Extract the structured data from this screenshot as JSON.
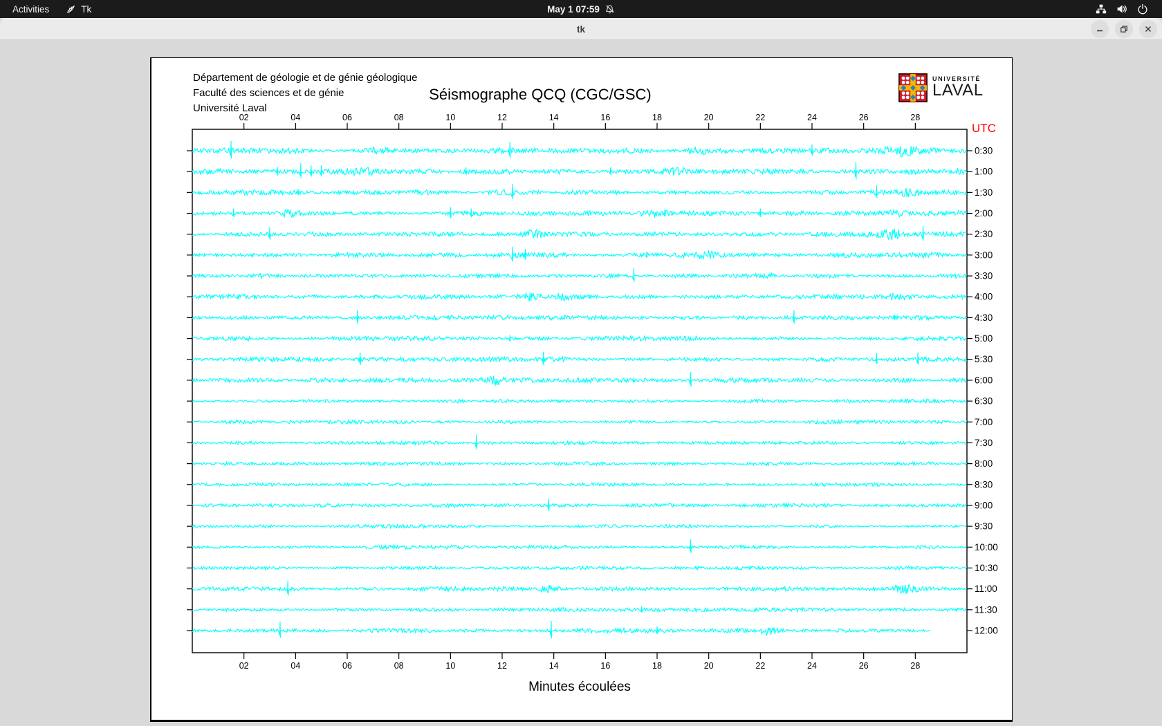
{
  "topbar": {
    "activities_label": "Activities",
    "app_menu_label": "Tk",
    "clock": "May 1 07:59"
  },
  "window": {
    "title": "tk"
  },
  "seismograph": {
    "institution_lines": [
      "Département de géologie et de génie géologique",
      "Faculté des sciences et de génie",
      "Université Laval"
    ],
    "title": "Séismographe QCQ (CGC/GSC)",
    "logo": {
      "top": "UNIVERSITÉ",
      "bottom": "LAVAL"
    },
    "utc_label": "UTC",
    "xlabel": "Minutes écoulées",
    "colors": {
      "trace": "#00ffff",
      "utc": "#ff0000",
      "axis": "#000000"
    }
  },
  "chart_data": {
    "type": "line",
    "subtype": "helicorder-seismograph",
    "title": "Séismographe QCQ (CGC/GSC)",
    "xlabel": "Minutes écoulées",
    "x_axis": {
      "min": 0,
      "max": 30,
      "tick_step": 2,
      "tick_labels": [
        "02",
        "04",
        "06",
        "08",
        "10",
        "12",
        "14",
        "16",
        "18",
        "20",
        "22",
        "24",
        "26",
        "28"
      ]
    },
    "y_axis_right_label": "UTC",
    "trace_color": "#00ffff",
    "rows": [
      {
        "label": "0:30",
        "amp": 2.8,
        "events": [
          {
            "m": 1.5,
            "t": "s",
            "a": 14
          },
          {
            "m": 7.3,
            "t": "b",
            "a": 3,
            "w": 0.6
          },
          {
            "m": 12.3,
            "t": "s",
            "a": 13
          },
          {
            "m": 19.6,
            "t": "b",
            "a": 4,
            "w": 0.6
          },
          {
            "m": 24.0,
            "t": "s",
            "a": 9
          },
          {
            "m": 27.5,
            "t": "b",
            "a": 5,
            "w": 0.9
          }
        ]
      },
      {
        "label": "1:00",
        "amp": 2.8,
        "events": [
          {
            "m": 3.3,
            "t": "s",
            "a": 7
          },
          {
            "m": 4.2,
            "t": "s",
            "a": 12
          },
          {
            "m": 4.6,
            "t": "s",
            "a": 9
          },
          {
            "m": 5.0,
            "t": "s",
            "a": 9
          },
          {
            "m": 6.6,
            "t": "b",
            "a": 4,
            "w": 0.5
          },
          {
            "m": 10.6,
            "t": "s",
            "a": 6
          },
          {
            "m": 16.2,
            "t": "s",
            "a": 6
          },
          {
            "m": 18.7,
            "t": "b",
            "a": 4,
            "w": 0.7
          },
          {
            "m": 25.7,
            "t": "s",
            "a": 14
          },
          {
            "m": 27.8,
            "t": "b",
            "a": 3,
            "w": 0.4
          }
        ]
      },
      {
        "label": "1:30",
        "amp": 2.6,
        "events": [
          {
            "m": 4.1,
            "t": "s",
            "a": 5
          },
          {
            "m": 12.4,
            "t": "s",
            "a": 12
          },
          {
            "m": 26.5,
            "t": "s",
            "a": 10
          },
          {
            "m": 27.7,
            "t": "b",
            "a": 5,
            "w": 0.7
          }
        ]
      },
      {
        "label": "2:00",
        "amp": 2.6,
        "events": [
          {
            "m": 1.6,
            "t": "s",
            "a": 7
          },
          {
            "m": 3.8,
            "t": "b",
            "a": 4,
            "w": 0.5
          },
          {
            "m": 10.0,
            "t": "s",
            "a": 9
          },
          {
            "m": 10.8,
            "t": "s",
            "a": 7
          },
          {
            "m": 17.9,
            "t": "b",
            "a": 4,
            "w": 0.8
          },
          {
            "m": 18.3,
            "t": "s",
            "a": 6
          },
          {
            "m": 22.0,
            "t": "s",
            "a": 7
          },
          {
            "m": 27.3,
            "t": "b",
            "a": 3,
            "w": 0.5
          }
        ]
      },
      {
        "label": "2:30",
        "amp": 2.6,
        "events": [
          {
            "m": 3.0,
            "t": "s",
            "a": 10
          },
          {
            "m": 13.2,
            "t": "b",
            "a": 5,
            "w": 0.6
          },
          {
            "m": 27.1,
            "t": "b",
            "a": 6,
            "w": 0.6
          },
          {
            "m": 28.3,
            "t": "s",
            "a": 12
          }
        ]
      },
      {
        "label": "3:00",
        "amp": 2.6,
        "events": [
          {
            "m": 12.4,
            "t": "s",
            "a": 12
          },
          {
            "m": 12.9,
            "t": "s",
            "a": 9
          },
          {
            "m": 17.6,
            "t": "s",
            "a": 5
          },
          {
            "m": 19.9,
            "t": "b",
            "a": 4,
            "w": 0.5
          }
        ]
      },
      {
        "label": "3:30",
        "amp": 2.4,
        "events": [
          {
            "m": 17.1,
            "t": "s",
            "a": 11
          }
        ]
      },
      {
        "label": "4:00",
        "amp": 2.4,
        "events": [
          {
            "m": 13.1,
            "t": "b",
            "a": 5,
            "w": 0.7
          },
          {
            "m": 14.3,
            "t": "b",
            "a": 4,
            "w": 0.5
          },
          {
            "m": 27.3,
            "t": "b",
            "a": 4,
            "w": 0.5
          }
        ]
      },
      {
        "label": "4:30",
        "amp": 2.4,
        "events": [
          {
            "m": 6.4,
            "t": "s",
            "a": 11
          },
          {
            "m": 23.3,
            "t": "s",
            "a": 11
          },
          {
            "m": 27.2,
            "t": "s",
            "a": 4
          }
        ]
      },
      {
        "label": "5:00",
        "amp": 2.2,
        "events": [
          {
            "m": 12.3,
            "t": "s",
            "a": 5
          }
        ]
      },
      {
        "label": "5:30",
        "amp": 2.4,
        "events": [
          {
            "m": 6.5,
            "t": "s",
            "a": 10
          },
          {
            "m": 13.6,
            "t": "s",
            "a": 11
          },
          {
            "m": 26.5,
            "t": "s",
            "a": 9
          },
          {
            "m": 28.1,
            "t": "s",
            "a": 10
          }
        ]
      },
      {
        "label": "6:00",
        "amp": 2.4,
        "events": [
          {
            "m": 11.8,
            "t": "b",
            "a": 5,
            "w": 0.5
          },
          {
            "m": 17.1,
            "t": "s",
            "a": 4
          },
          {
            "m": 19.3,
            "t": "s",
            "a": 12
          }
        ]
      },
      {
        "label": "6:30",
        "amp": 1.8,
        "events": []
      },
      {
        "label": "7:00",
        "amp": 1.9,
        "events": []
      },
      {
        "label": "7:30",
        "amp": 1.8,
        "events": [
          {
            "m": 11.0,
            "t": "s",
            "a": 12
          }
        ]
      },
      {
        "label": "8:00",
        "amp": 1.8,
        "events": []
      },
      {
        "label": "8:30",
        "amp": 1.7,
        "events": []
      },
      {
        "label": "9:00",
        "amp": 1.8,
        "events": [
          {
            "m": 13.8,
            "t": "s",
            "a": 10
          }
        ]
      },
      {
        "label": "9:30",
        "amp": 1.7,
        "events": []
      },
      {
        "label": "10:00",
        "amp": 1.8,
        "events": [
          {
            "m": 19.3,
            "t": "s",
            "a": 11
          }
        ]
      },
      {
        "label": "10:30",
        "amp": 1.7,
        "events": []
      },
      {
        "label": "11:00",
        "amp": 2.2,
        "events": [
          {
            "m": 3.7,
            "t": "s",
            "a": 12
          },
          {
            "m": 13.8,
            "t": "b",
            "a": 5,
            "w": 0.6
          },
          {
            "m": 27.6,
            "t": "b",
            "a": 6,
            "w": 0.8
          }
        ]
      },
      {
        "label": "11:30",
        "amp": 2.0,
        "events": [
          {
            "m": 17.4,
            "t": "s",
            "a": 5
          }
        ]
      },
      {
        "label": "12:00",
        "amp": 2.2,
        "end": 28.6,
        "events": [
          {
            "m": 3.4,
            "t": "s",
            "a": 13
          },
          {
            "m": 13.9,
            "t": "s",
            "a": 14
          },
          {
            "m": 18.0,
            "t": "s",
            "a": 6
          },
          {
            "m": 22.3,
            "t": "b",
            "a": 5,
            "w": 0.5
          }
        ]
      }
    ]
  }
}
